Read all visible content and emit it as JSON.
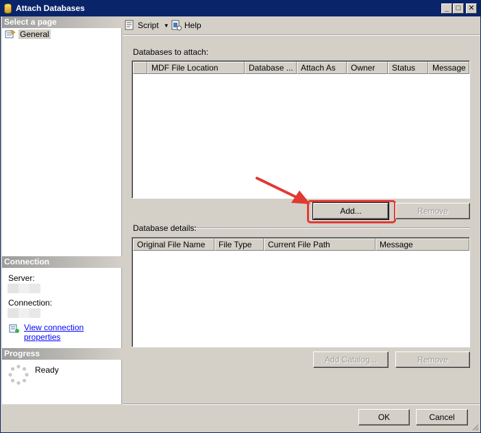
{
  "window": {
    "title": "Attach Databases",
    "controls": {
      "minimize": "_",
      "maximize": "□",
      "close": "✕"
    }
  },
  "left_pane": {
    "select_page_header": "Select a page",
    "pages": [
      {
        "label": "General",
        "icon": "page-properties-icon"
      }
    ],
    "connection_header": "Connection",
    "server_label": "Server:",
    "connection_label": "Connection:",
    "view_connection_link": "View connection properties",
    "progress_header": "Progress",
    "progress_status": "Ready"
  },
  "toolbar": {
    "script_label": "Script",
    "help_label": "Help"
  },
  "attach_section": {
    "label": "Databases to attach:",
    "columns": [
      "",
      "MDF File Location",
      "Database ...",
      "Attach As",
      "Owner",
      "Status",
      "Message"
    ],
    "rows": [],
    "add_button": "Add...",
    "remove_button": "Remove"
  },
  "details_section": {
    "label": "Database details:",
    "columns": [
      "Original File Name",
      "File Type",
      "Current File Path",
      "Message"
    ],
    "rows": [],
    "add_catalog_button": "Add Catalog...",
    "remove_button": "Remove"
  },
  "footer": {
    "ok_button": "OK",
    "cancel_button": "Cancel"
  },
  "colors": {
    "titlebar": "#0a246a",
    "face": "#d4d0c8",
    "link": "#0000ff",
    "annotation_red": "#e03a33"
  }
}
